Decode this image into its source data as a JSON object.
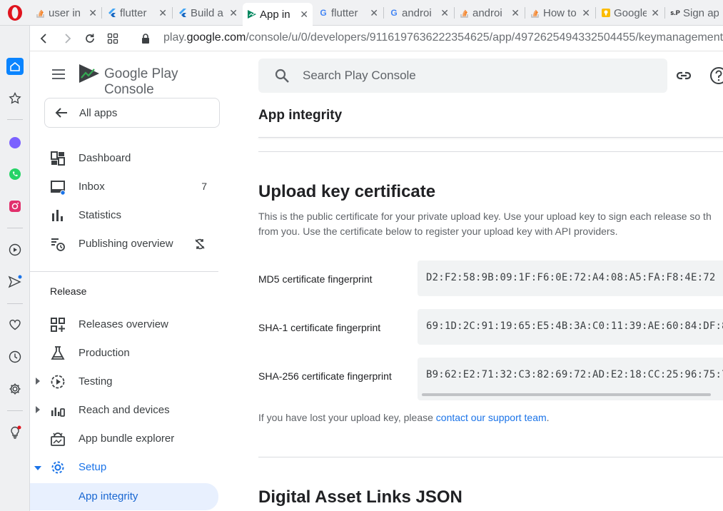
{
  "browser": {
    "tabs": [
      {
        "label": "user in",
        "favicon": "stackoverflow-icon"
      },
      {
        "label": "flutter",
        "favicon": "flutter-icon"
      },
      {
        "label": "Build a",
        "favicon": "flutter-icon"
      },
      {
        "label": "App in",
        "favicon": "play-console-icon",
        "active": true
      },
      {
        "label": "flutter",
        "favicon": "google-icon"
      },
      {
        "label": "androi",
        "favicon": "google-icon"
      },
      {
        "label": "androi",
        "favicon": "stackoverflow-icon"
      },
      {
        "label": "How to",
        "favicon": "stackoverflow-icon"
      },
      {
        "label": "Google",
        "favicon": "google-keep-icon"
      },
      {
        "label": "Sign ap",
        "favicon": "sp-icon"
      }
    ],
    "close_glyph": "✕",
    "url_prefix": "play.",
    "url_domain": "google.com",
    "url_path": "/console/u/0/developers/9116197636222354625/app/4972625494332504455/keymanagement"
  },
  "header": {
    "app_title": "Google Play Console",
    "search_placeholder": "Search Play Console"
  },
  "nav": {
    "all_apps": "All apps",
    "items": [
      {
        "label": "Dashboard",
        "icon": "dashboard-icon"
      },
      {
        "label": "Inbox",
        "icon": "inbox-icon",
        "count": "7"
      },
      {
        "label": "Statistics",
        "icon": "statistics-icon"
      },
      {
        "label": "Publishing overview",
        "icon": "publishing-overview-icon"
      }
    ],
    "section_release": "Release",
    "release_items": [
      {
        "label": "Releases overview",
        "icon": "releases-overview-icon"
      },
      {
        "label": "Production",
        "icon": "production-icon"
      },
      {
        "label": "Testing",
        "icon": "testing-icon"
      },
      {
        "label": "Reach and devices",
        "icon": "reach-devices-icon"
      },
      {
        "label": "App bundle explorer",
        "icon": "app-bundle-icon"
      },
      {
        "label": "Setup",
        "icon": "setup-gear-icon"
      },
      {
        "label": "App integrity",
        "icon": ""
      }
    ]
  },
  "main": {
    "page_title": "App integrity",
    "upload_heading": "Upload key certificate",
    "upload_desc_line1": "This is the public certificate for your private upload key. Use your upload key to sign each release so th",
    "upload_desc_line2": "from you. Use the certificate below to register your upload key with API providers.",
    "fingerprints": [
      {
        "label": "MD5 certificate fingerprint",
        "value": "D2:F2:58:9B:09:1F:F6:0E:72:A4:08:A5:FA:F8:4E:72"
      },
      {
        "label": "SHA-1 certificate fingerprint",
        "value": "69:1D:2C:91:19:65:E5:4B:3A:C0:11:39:AE:60:84:DF:8"
      },
      {
        "label": "SHA-256 certificate fingerprint",
        "value": "B9:62:E2:71:32:C3:82:69:72:AD:E2:18:CC:25:96:75:7"
      }
    ],
    "lost_key_text": "If you have lost your upload key, please ",
    "lost_key_link": "contact our support team",
    "lost_key_end": ".",
    "digital_heading": "Digital Asset Links JSON"
  },
  "colors": {
    "accent": "#1a73e8",
    "selected_bg": "#e8f0fe",
    "opera_red": "#e0141e"
  }
}
